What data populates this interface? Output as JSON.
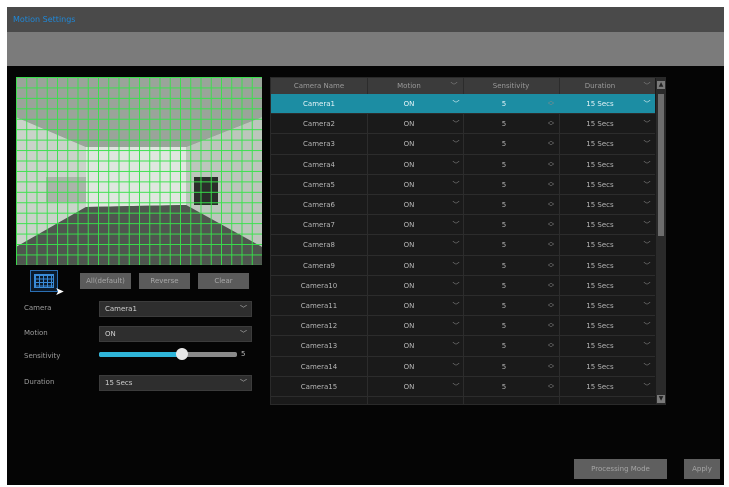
{
  "window": {
    "title": "Motion Settings"
  },
  "preview": {
    "grid_color": "#37e24a"
  },
  "area_buttons": {
    "all": "All(default)",
    "reverse": "Reverse",
    "clear": "Clear"
  },
  "form": {
    "camera_label": "Camera",
    "camera_value": "Camera1",
    "motion_label": "Motion",
    "motion_value": "ON",
    "sensitivity_label": "Sensitivity",
    "sensitivity_value": "5",
    "sensitivity_fraction": 0.6,
    "duration_label": "Duration",
    "duration_value": "15 Secs"
  },
  "table": {
    "headers": {
      "camera": "Camera Name",
      "motion": "Motion",
      "sensitivity": "Sensitivity",
      "duration": "Duration"
    },
    "rows": [
      {
        "camera": "Camera1",
        "motion": "ON",
        "sensitivity": "5",
        "duration": "15 Secs",
        "selected": true
      },
      {
        "camera": "Camera2",
        "motion": "ON",
        "sensitivity": "5",
        "duration": "15 Secs"
      },
      {
        "camera": "Camera3",
        "motion": "ON",
        "sensitivity": "5",
        "duration": "15 Secs"
      },
      {
        "camera": "Camera4",
        "motion": "ON",
        "sensitivity": "5",
        "duration": "15 Secs"
      },
      {
        "camera": "Camera5",
        "motion": "ON",
        "sensitivity": "5",
        "duration": "15 Secs"
      },
      {
        "camera": "Camera6",
        "motion": "ON",
        "sensitivity": "5",
        "duration": "15 Secs"
      },
      {
        "camera": "Camera7",
        "motion": "ON",
        "sensitivity": "5",
        "duration": "15 Secs"
      },
      {
        "camera": "Camera8",
        "motion": "ON",
        "sensitivity": "5",
        "duration": "15 Secs"
      },
      {
        "camera": "Camera9",
        "motion": "ON",
        "sensitivity": "5",
        "duration": "15 Secs"
      },
      {
        "camera": "Camera10",
        "motion": "ON",
        "sensitivity": "5",
        "duration": "15 Secs"
      },
      {
        "camera": "Camera11",
        "motion": "ON",
        "sensitivity": "5",
        "duration": "15 Secs"
      },
      {
        "camera": "Camera12",
        "motion": "ON",
        "sensitivity": "5",
        "duration": "15 Secs"
      },
      {
        "camera": "Camera13",
        "motion": "ON",
        "sensitivity": "5",
        "duration": "15 Secs"
      },
      {
        "camera": "Camera14",
        "motion": "ON",
        "sensitivity": "5",
        "duration": "15 Secs"
      },
      {
        "camera": "Camera15",
        "motion": "ON",
        "sensitivity": "5",
        "duration": "15 Secs"
      }
    ]
  },
  "footer": {
    "processing_mode": "Processing Mode",
    "apply": "Apply"
  },
  "colors": {
    "accent": "#1e88d9",
    "selected_row": "#1c8da3",
    "slider_fill": "#2fb5d9"
  }
}
